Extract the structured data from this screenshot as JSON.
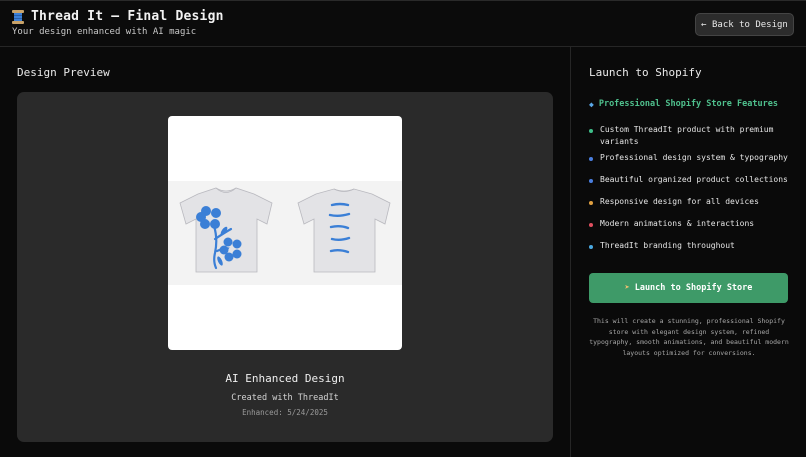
{
  "header": {
    "icon": "spool-of-thread-icon",
    "title": "Thread It – Final Design",
    "subtitle": "Your design enhanced with AI magic",
    "back_label": "← Back to Design"
  },
  "preview": {
    "section_title": "Design Preview",
    "design_name": "AI Enhanced Design",
    "created_with": "Created with ThreadIt",
    "enhanced": "Enhanced: 5/24/2025"
  },
  "shopify": {
    "section_title": "Launch to Shopify",
    "features_icon": "gem-icon",
    "features_title": "Professional Shopify Store Features",
    "features": [
      {
        "text": "Custom ThreadIt product with premium variants",
        "color": "#3fbf8a"
      },
      {
        "text": "Professional design system & typography",
        "color": "#4a7fe0"
      },
      {
        "text": "Beautiful organized product collections",
        "color": "#4a7fe0"
      },
      {
        "text": "Responsive design for all devices",
        "color": "#e0a040"
      },
      {
        "text": "Modern animations & interactions",
        "color": "#e05060"
      },
      {
        "text": "ThreadIt branding throughout",
        "color": "#4aa8e0"
      }
    ],
    "launch_icon": "rocket-icon",
    "launch_label": "Launch to Shopify Store",
    "note": "This will create a stunning, professional Shopify store with elegant design system, refined typography, smooth animations, and beautiful modern layouts optimized for conversions."
  },
  "colors": {
    "background": "#0a0a0a",
    "card": "#2a2a2a",
    "accent_green": "#3e9a68",
    "feature_title_green": "#4fc08d",
    "print_blue": "#3b7fd6"
  }
}
